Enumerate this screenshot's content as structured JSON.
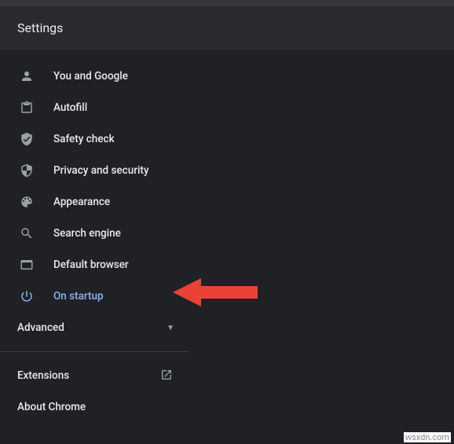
{
  "header": {
    "title": "Settings"
  },
  "nav": {
    "you": {
      "label": "You and Google"
    },
    "autofill": {
      "label": "Autofill"
    },
    "safety": {
      "label": "Safety check"
    },
    "privacy": {
      "label": "Privacy and security"
    },
    "appear": {
      "label": "Appearance"
    },
    "search": {
      "label": "Search engine"
    },
    "default": {
      "label": "Default browser"
    },
    "startup": {
      "label": "On startup"
    }
  },
  "advanced": {
    "label": "Advanced"
  },
  "extensions": {
    "label": "Extensions"
  },
  "about": {
    "label": "About Chrome"
  },
  "watermark": "wsxdn.com",
  "colors": {
    "accent": "#8ab4f8",
    "annotation": "#ea4335"
  }
}
